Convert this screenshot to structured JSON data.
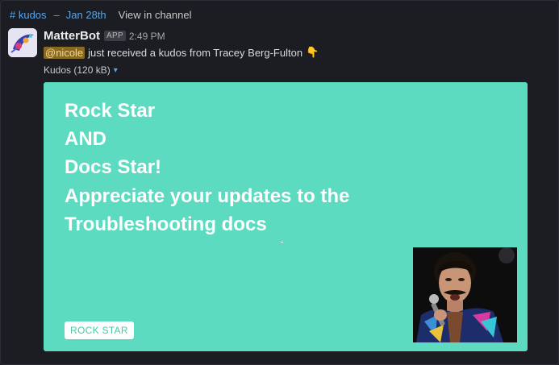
{
  "header": {
    "channel": "# kudos",
    "separator": "–",
    "date": "Jan 28th",
    "view_link": "View in channel"
  },
  "post": {
    "username": "MatterBot",
    "badge": "APP",
    "time": "2:49 PM",
    "mention": "@nicole",
    "message": "just received a kudos from Tracey Berg-Fulton",
    "emoji": "👇"
  },
  "attachment": {
    "label": "Kudos (120 kB)",
    "caret": "▾",
    "card_lines": [
      "Rock Star",
      "AND",
      "Docs Star!",
      "Appreciate your updates to the",
      "Troubleshooting docs"
    ],
    "badge_label": "ROCK STAR"
  },
  "colors": {
    "background": "#1b1d22",
    "link": "#5ba4e6",
    "card": "#5cdbc0",
    "mention_bg": "#8a6a1f"
  }
}
